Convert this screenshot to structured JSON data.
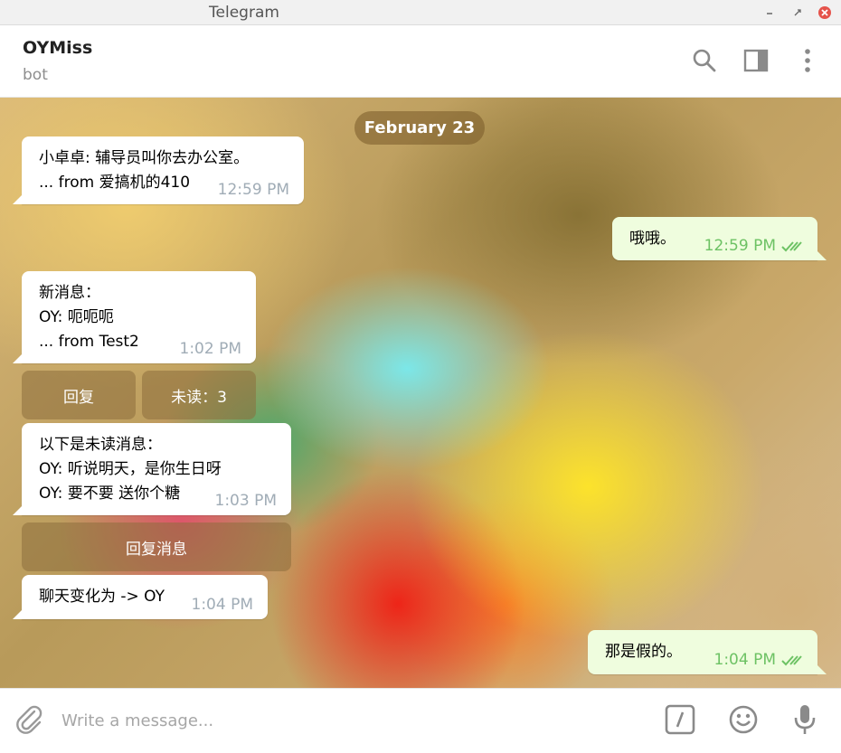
{
  "window": {
    "title": "Telegram"
  },
  "header": {
    "name": "OYMiss",
    "status": "bot"
  },
  "chat": {
    "date": "February 23",
    "messages": [
      {
        "lines": [
          "小卓卓: 辅导员叫你去办公室。",
          "... from 爱搞机的410"
        ],
        "time": "12:59 PM",
        "direction": "in"
      },
      {
        "lines": [
          "哦哦。"
        ],
        "time": "12:59 PM",
        "direction": "out"
      },
      {
        "lines": [
          "新消息：",
          "OY: 呃呃呃",
          "... from Test2"
        ],
        "time": "1:02 PM",
        "direction": "in"
      },
      {
        "lines": [
          "以下是未读消息：",
          "OY: 听说明天，是你生日呀",
          "OY: 要不要 送你个糖"
        ],
        "time": "1:03 PM",
        "direction": "in"
      },
      {
        "lines": [
          "聊天变化为 -> OY"
        ],
        "time": "1:04 PM",
        "direction": "in"
      },
      {
        "lines": [
          "那是假的。"
        ],
        "time": "1:04 PM",
        "direction": "out"
      }
    ],
    "keyboard1": [
      "回复",
      "未读：3"
    ],
    "keyboard2": [
      "回复消息"
    ]
  },
  "composer": {
    "placeholder": "Write a message..."
  },
  "icons": {
    "search": "search-icon",
    "panel": "side-panel-icon",
    "more": "more-vertical-icon",
    "attach": "paperclip-icon",
    "command": "bot-command-icon",
    "emoji": "emoji-icon",
    "mic": "microphone-icon",
    "read": "double-check-icon"
  },
  "colors": {
    "accent": "#6dc264",
    "outgoing_bubble": "#effdde",
    "time_in": "#a0acb6",
    "close_button": "#e5534b"
  }
}
